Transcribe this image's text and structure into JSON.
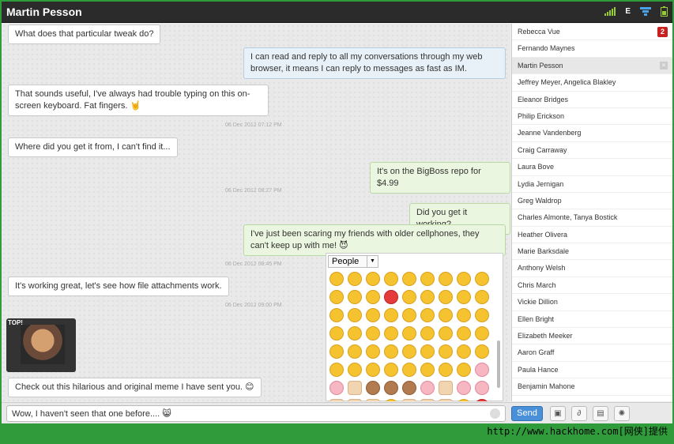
{
  "window": {
    "title": "Martin Pesson"
  },
  "status_bar": {
    "network_label": "E"
  },
  "chat": {
    "messages": [
      {
        "text": "What does that particular tweak do?"
      },
      {
        "text": "I can read and reply to all my conversations through my web browser, it means I can reply to messages as fast as IM."
      },
      {
        "text": "That sounds useful, I've always had trouble typing on this on-screen keyboard. Fat fingers. 🤘"
      },
      {
        "text": "Where did you get it from, I can't find it..."
      },
      {
        "text": "It's on the BigBoss repo for $4.99"
      },
      {
        "text": "Did you get it working?"
      },
      {
        "text": "I've just been scaring my friends with older cellphones, they can't keep up with me! 😈"
      },
      {
        "text": "It's working great, let's see how file attachments work."
      },
      {
        "text": "Check out this hilarious and original meme I have sent you. 😊"
      }
    ],
    "timestamps": [
      "06 Dec 2012 07:12 PM",
      "06 Dec 2012 08:27 PM",
      "06 Dec 2012 08:45 PM",
      "06 Dec 2012 09:00 PM"
    ],
    "meme_caption": "TOP!"
  },
  "emoji_picker": {
    "category": "People"
  },
  "contacts": [
    {
      "name": "Rebecca Vue",
      "badge": "2"
    },
    {
      "name": "Fernando Maynes"
    },
    {
      "name": "Martin Pesson"
    },
    {
      "name": "Jeffrey Meyer, Angelica Blakley"
    },
    {
      "name": "Eleanor Bridges"
    },
    {
      "name": "Philip Erickson"
    },
    {
      "name": "Jeanne Vandenberg"
    },
    {
      "name": "Craig Carraway"
    },
    {
      "name": "Laura Bove"
    },
    {
      "name": "Lydia Jernigan"
    },
    {
      "name": "Greg Waldrop"
    },
    {
      "name": "Charles Almonte, Tanya Bostick"
    },
    {
      "name": "Heather Olivera"
    },
    {
      "name": "Marie Barksdale"
    },
    {
      "name": "Anthony Welsh"
    },
    {
      "name": "Chris March"
    },
    {
      "name": "Vickie Dillion"
    },
    {
      "name": "Ellen Bright"
    },
    {
      "name": "Elizabeth Meeker"
    },
    {
      "name": "Aaron Graff"
    },
    {
      "name": "Paula Hance"
    },
    {
      "name": "Benjamin Mahone"
    }
  ],
  "composer": {
    "value": "Wow, I haven't seen that one before.... 😸",
    "send_label": "Send"
  },
  "watermark": "http://www.hackhome.com[网侠]提供"
}
